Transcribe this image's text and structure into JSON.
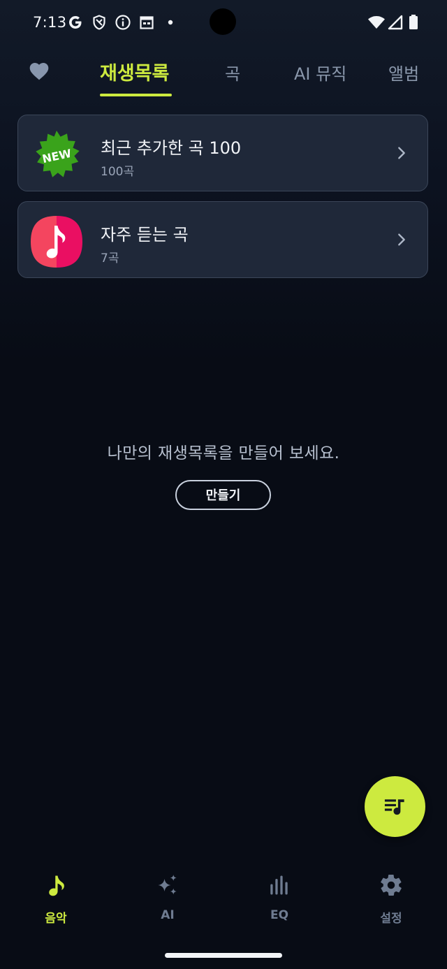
{
  "status_bar": {
    "time": "7:13",
    "left_icons": [
      "google-g-icon",
      "vpn-shield-icon",
      "info-icon",
      "calendar-icon",
      "dot-icon"
    ],
    "right_icons": [
      "wifi-icon",
      "signal-icon",
      "battery-icon"
    ]
  },
  "top_tabs": [
    {
      "label": "재생목록",
      "active": true
    },
    {
      "label": "곡",
      "active": false
    },
    {
      "label": "AI 뮤직",
      "active": false
    },
    {
      "label": "앨범",
      "active": false
    }
  ],
  "playlists": [
    {
      "title": "최근 추가한 곡 100",
      "count": "100곡",
      "thumb_icon": "new-badge-icon",
      "badge_text": "NEW"
    },
    {
      "title": "자주 듣는 곡",
      "count": "7곡",
      "thumb_icon": "music-note-icon"
    }
  ],
  "empty_state": {
    "message": "나만의 재생목록을 만들어 보세요.",
    "button_label": "만들기"
  },
  "fab": {
    "icon": "queue-music-icon"
  },
  "bottom_nav": [
    {
      "label": "음악",
      "icon": "music-note-icon",
      "active": true
    },
    {
      "label": "AI",
      "icon": "sparkle-icon",
      "active": false
    },
    {
      "label": "EQ",
      "icon": "equalizer-icon",
      "active": false
    },
    {
      "label": "설정",
      "icon": "gear-icon",
      "active": false
    }
  ],
  "colors": {
    "accent": "#cdea3f",
    "background": "#080c15",
    "card": "#1f2839",
    "inactive": "#6f7c91",
    "new_badge": "#3aa31b",
    "music_icon_pink": "#f0145f"
  }
}
